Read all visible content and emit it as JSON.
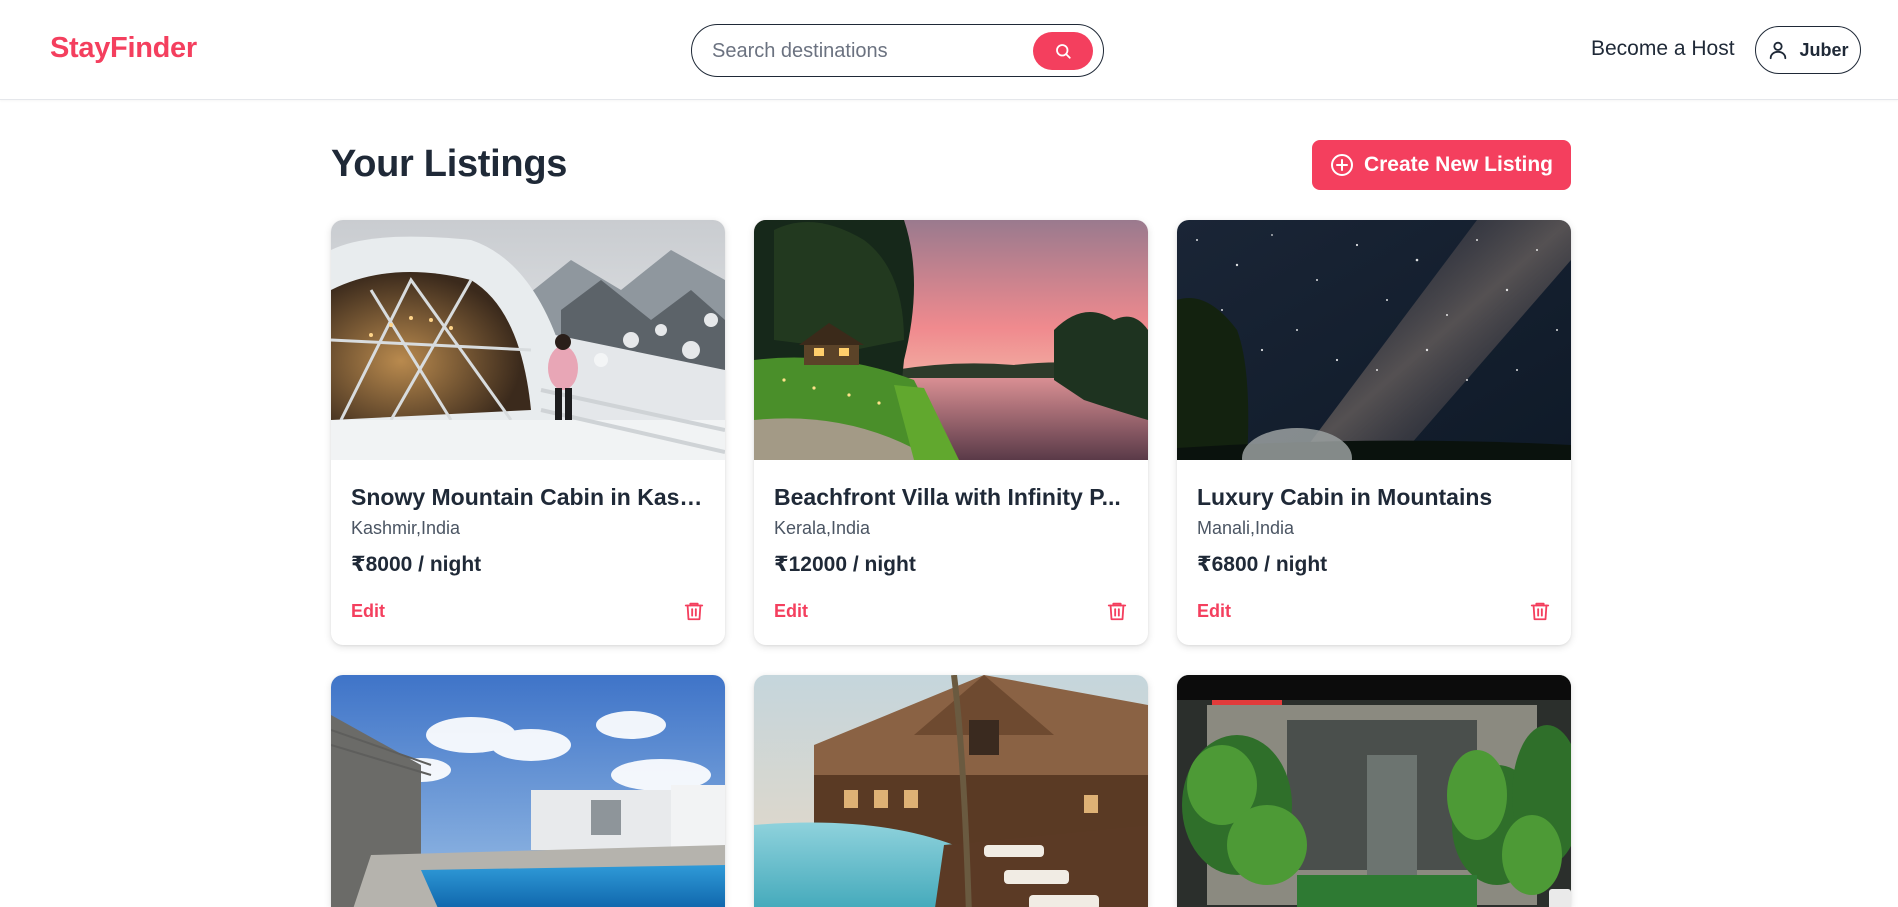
{
  "header": {
    "logo": "StayFinder",
    "search_placeholder": "Search destinations",
    "host_link": "Become a Host",
    "user_name": "Juber"
  },
  "main": {
    "title": "Your Listings",
    "create_button": "Create New Listing"
  },
  "listings": [
    {
      "title": "Snowy Mountain Cabin in Kash...",
      "location": "Kashmir,India",
      "price": "₹8000 / night",
      "edit": "Edit"
    },
    {
      "title": "Beachfront Villa with Infinity P...",
      "location": "Kerala,India",
      "price": "₹12000 / night",
      "edit": "Edit"
    },
    {
      "title": "Luxury Cabin in Mountains",
      "location": "Manali,India",
      "price": "₹6800 / night",
      "edit": "Edit"
    }
  ],
  "colors": {
    "accent": "#f43f5e",
    "text": "#1f2937",
    "muted": "#4b5563"
  },
  "icons": [
    "search-icon",
    "user-icon",
    "plus-circle-icon",
    "trash-icon"
  ]
}
